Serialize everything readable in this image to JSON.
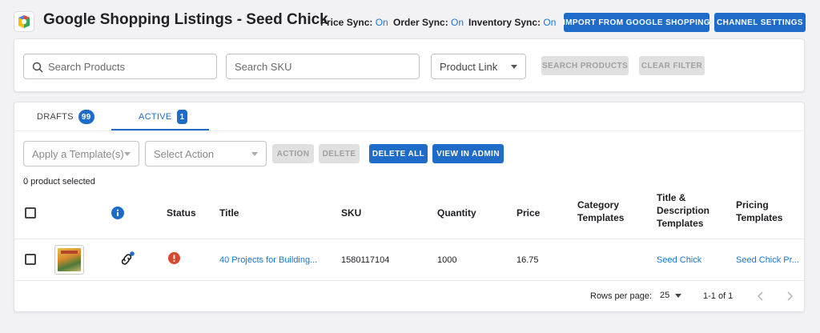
{
  "header": {
    "title": "Google Shopping Listings - Seed Chick",
    "price_sync_label": "Price Sync:",
    "price_sync_value": "On",
    "order_sync_label": "Order Sync:",
    "order_sync_value": "On",
    "inventory_sync_label": "Inventory Sync:",
    "inventory_sync_value": "On",
    "import_button": "IMPORT FROM GOOGLE SHOPPING",
    "settings_button": "CHANNEL SETTINGS"
  },
  "search": {
    "products_placeholder": "Search Products",
    "sku_placeholder": "Search SKU",
    "link_select": "Product Link",
    "search_button": "SEARCH PRODUCTS",
    "clear_button": "CLEAR FILTER"
  },
  "tabs": [
    {
      "label": "DRAFTS",
      "count": "99"
    },
    {
      "label": "ACTIVE",
      "count": "1"
    }
  ],
  "actions": {
    "template_select": "Apply a Template(s)",
    "action_select": "Select Action",
    "action_button": "ACTION",
    "delete_button": "DELETE",
    "delete_all_button": "DELETE ALL",
    "view_admin_button": "VIEW IN ADMIN",
    "selected_text": "0 product selected"
  },
  "table": {
    "columns": {
      "status": "Status",
      "title": "Title",
      "sku": "SKU",
      "quantity": "Quantity",
      "price": "Price",
      "category_templates": "Category Templates",
      "title_description_templates": "Title & Description Templates",
      "pricing_templates": "Pricing Templates"
    },
    "rows": [
      {
        "title": "40 Projects for Building...",
        "sku": "1580117104",
        "quantity": "1000",
        "price": "16.75",
        "category_template": "",
        "title_description_template": "Seed Chick",
        "pricing_template": "Seed Chick Pr..."
      }
    ]
  },
  "pagination": {
    "rows_per_page_label": "Rows per page:",
    "rows_per_page_value": "25",
    "range": "1-1 of 1"
  },
  "colors": {
    "accent": "#1e6cc8",
    "link": "#1976d2",
    "error": "#d9462e"
  }
}
